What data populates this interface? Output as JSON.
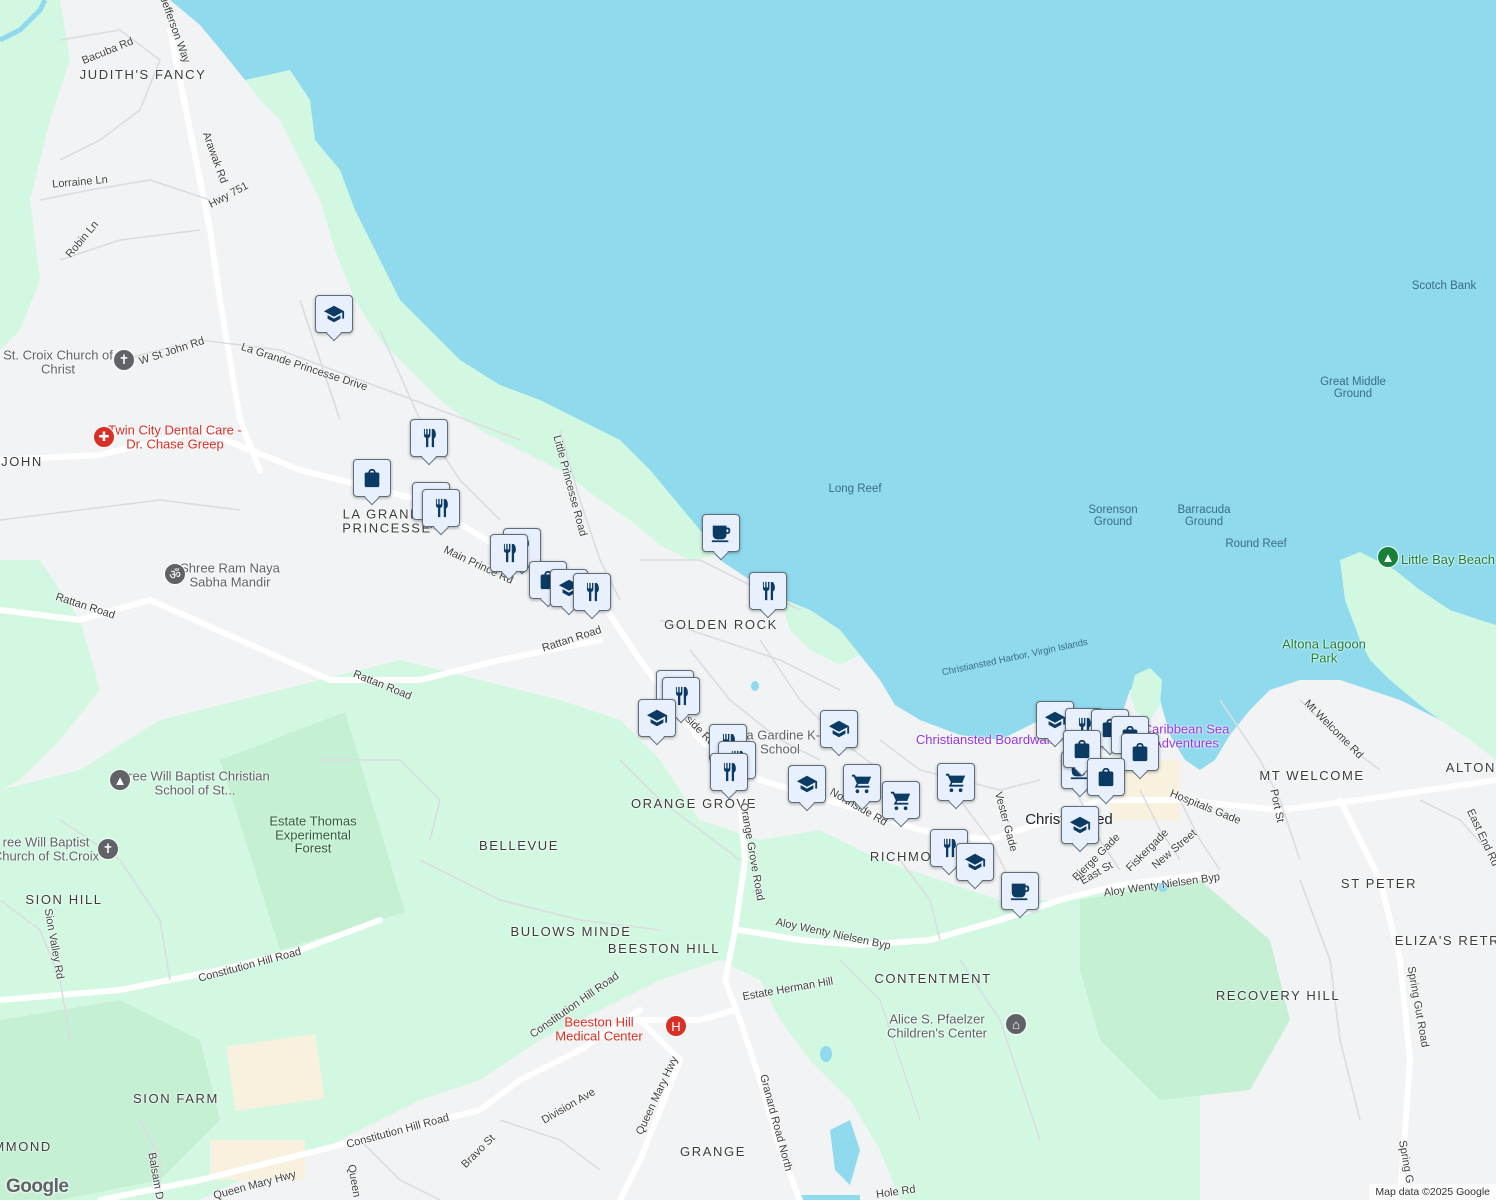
{
  "colors": {
    "water": "#8fdaed",
    "land": "#f1f3f4",
    "park": "#d3f8e2",
    "forest": "#c5f0d4",
    "road": "#ffffff",
    "minor_road": "#dadce0",
    "pin_icon": "#0b3a63",
    "hospital": "#d93025"
  },
  "labels": {
    "judiths_fancy": "JUDITH'S FANCY",
    "la_grande_princesse": "LA GRANDE PRINCESSE",
    "john": "JOHN",
    "golden_rock": "GOLDEN ROCK",
    "orange_grove": "ORANGE GROVE",
    "bellevue": "BELLEVUE",
    "sion_hill": "SION HILL",
    "bulows_minde": "BULOWS MINDE",
    "beeston_hill": "BEESTON HILL",
    "contentment": "CONTENTMENT",
    "recovery_hill": "RECOVERY HILL",
    "richmond": "RICHMOND",
    "mt_welcome": "MT WELCOME",
    "altona": "ALTONA",
    "st_peter": "ST PETER",
    "elizas_retreat": "ELIZA'S RETREAT",
    "sion_farm": "SION FARM",
    "grange": "GRANGE",
    "hammond": "HAMMOND",
    "christiansted": "Christiansted"
  },
  "water_labels": {
    "scotch_bank": "Scotch Bank",
    "great_middle_ground": "Great Middle Ground",
    "long_reef": "Long Reef",
    "sorenson_ground": "Sorenson Ground",
    "barracuda_ground": "Barracuda Ground",
    "round_reef": "Round Reef",
    "christiansted_harbor": "Christiansted Harbor, Virgin Islands"
  },
  "roads": {
    "jefferson_way": "Jefferson Way",
    "bacuba_rd": "Bacuba Rd",
    "arawak_rd": "Arawak Rd",
    "hwy_751": "Hwy 751",
    "lorraine_ln": "Lorraine Ln",
    "robin_ln": "Robin Ln",
    "w_st_john_rd": "W St John Rd",
    "la_grande_princesse_drive": "La Grande Princesse Drive",
    "little_princesse_road": "Little Princesse Road",
    "main_prince_rd": "Main Prince Rd",
    "rattan_road_1": "Rattan Road",
    "rattan_road_2": "Rattan Road",
    "rattan_road_3": "Rattan Road",
    "northside_rd": "Northside Rd",
    "orange_grove_road": "Orange Grove Road",
    "northside_rd_2": "Northside Rd",
    "vester_gade": "Vester Gade",
    "hospitals_gade": "Hospitals Gade",
    "port_st": "Port St",
    "mt_welcome_rd": "Mt Welcome Rd",
    "east_end_rd": "East End Rd",
    "bjerge_gade": "Bjerge Gade",
    "east_st": "East St",
    "fiskergade": "Fiskergade",
    "new_street": "New Street",
    "aloy_1": "Aloy Wenty Nielsen Byp",
    "aloy_2": "Aloy Wenty Nielsen Byp",
    "spring_gut_road": "Spring Gut Road",
    "spring_gut_2": "Spring G",
    "constitution_hill_road_1": "Constitution Hill Road",
    "constitution_hill_road_2": "Constitution Hill Road",
    "constitution_hill_road_3": "Constitution Hill Road",
    "estate_herman_hill": "Estate Herman Hill",
    "granard_road_north": "Granard Road North",
    "queen_mary_hwy_1": "Queen Mary Hwy",
    "queen_mary_hwy_2": "Queen Mary Hwy",
    "division_ave": "Division Ave",
    "bravo_st": "Bravo St",
    "sion_valley_rd": "Sion Valley Rd",
    "balsam_dr": "Balsam Dr",
    "queen_street": "Queen",
    "hole_rd": "Hole Rd"
  },
  "pois": {
    "st_croix_church": "St. Croix Church of Christ",
    "twin_city_dental": "Twin City Dental Care - Dr. Chase Greep",
    "shree_ram": "Shree Ram Naya Sabha Mandir",
    "free_will_baptist_school": "Free Will Baptist Christian School of St...",
    "free_will_baptist_church": "ree Will Baptist Church of St.Croix",
    "estate_thomas": "Estate Thomas Experimental Forest",
    "pearl_b_larsen": "nita Gardine K-8 School",
    "christiansted_boardwalk": "Christiansted Boardwalk",
    "caribbean_sea_adventures": "Caribbean Sea Adventures",
    "little_bay_beach": "Little Bay Beach",
    "altona_lagoon_park": "Altona Lagoon Park",
    "alice_pfaelzer": "Alice S. Pfaelzer Children's Center",
    "beeston_hill_medical": "Beeston Hill Medical Center"
  },
  "markers": [
    {
      "icon": "school"
    },
    {
      "icon": "restaurant"
    },
    {
      "icon": "shopping"
    },
    {
      "icon": "restaurant"
    },
    {
      "icon": "restaurant"
    },
    {
      "icon": "restaurant"
    },
    {
      "icon": "restaurant"
    },
    {
      "icon": "shopping"
    },
    {
      "icon": "school"
    },
    {
      "icon": "restaurant"
    },
    {
      "icon": "cafe"
    },
    {
      "icon": "restaurant"
    },
    {
      "icon": "restaurant"
    },
    {
      "icon": "restaurant"
    },
    {
      "icon": "school"
    },
    {
      "icon": "restaurant"
    },
    {
      "icon": "restaurant"
    },
    {
      "icon": "restaurant"
    },
    {
      "icon": "school"
    },
    {
      "icon": "school"
    },
    {
      "icon": "grocery"
    },
    {
      "icon": "grocery"
    },
    {
      "icon": "grocery"
    },
    {
      "icon": "restaurant"
    },
    {
      "icon": "school"
    },
    {
      "icon": "cafe"
    },
    {
      "icon": "school"
    },
    {
      "icon": "restaurant"
    },
    {
      "icon": "shopping"
    },
    {
      "icon": "shopping"
    },
    {
      "icon": "shopping"
    },
    {
      "icon": "cafe"
    },
    {
      "icon": "shopping"
    },
    {
      "icon": "shopping"
    },
    {
      "icon": "school"
    }
  ],
  "attribution": "Map data ©2025 Google",
  "logo": "Google"
}
